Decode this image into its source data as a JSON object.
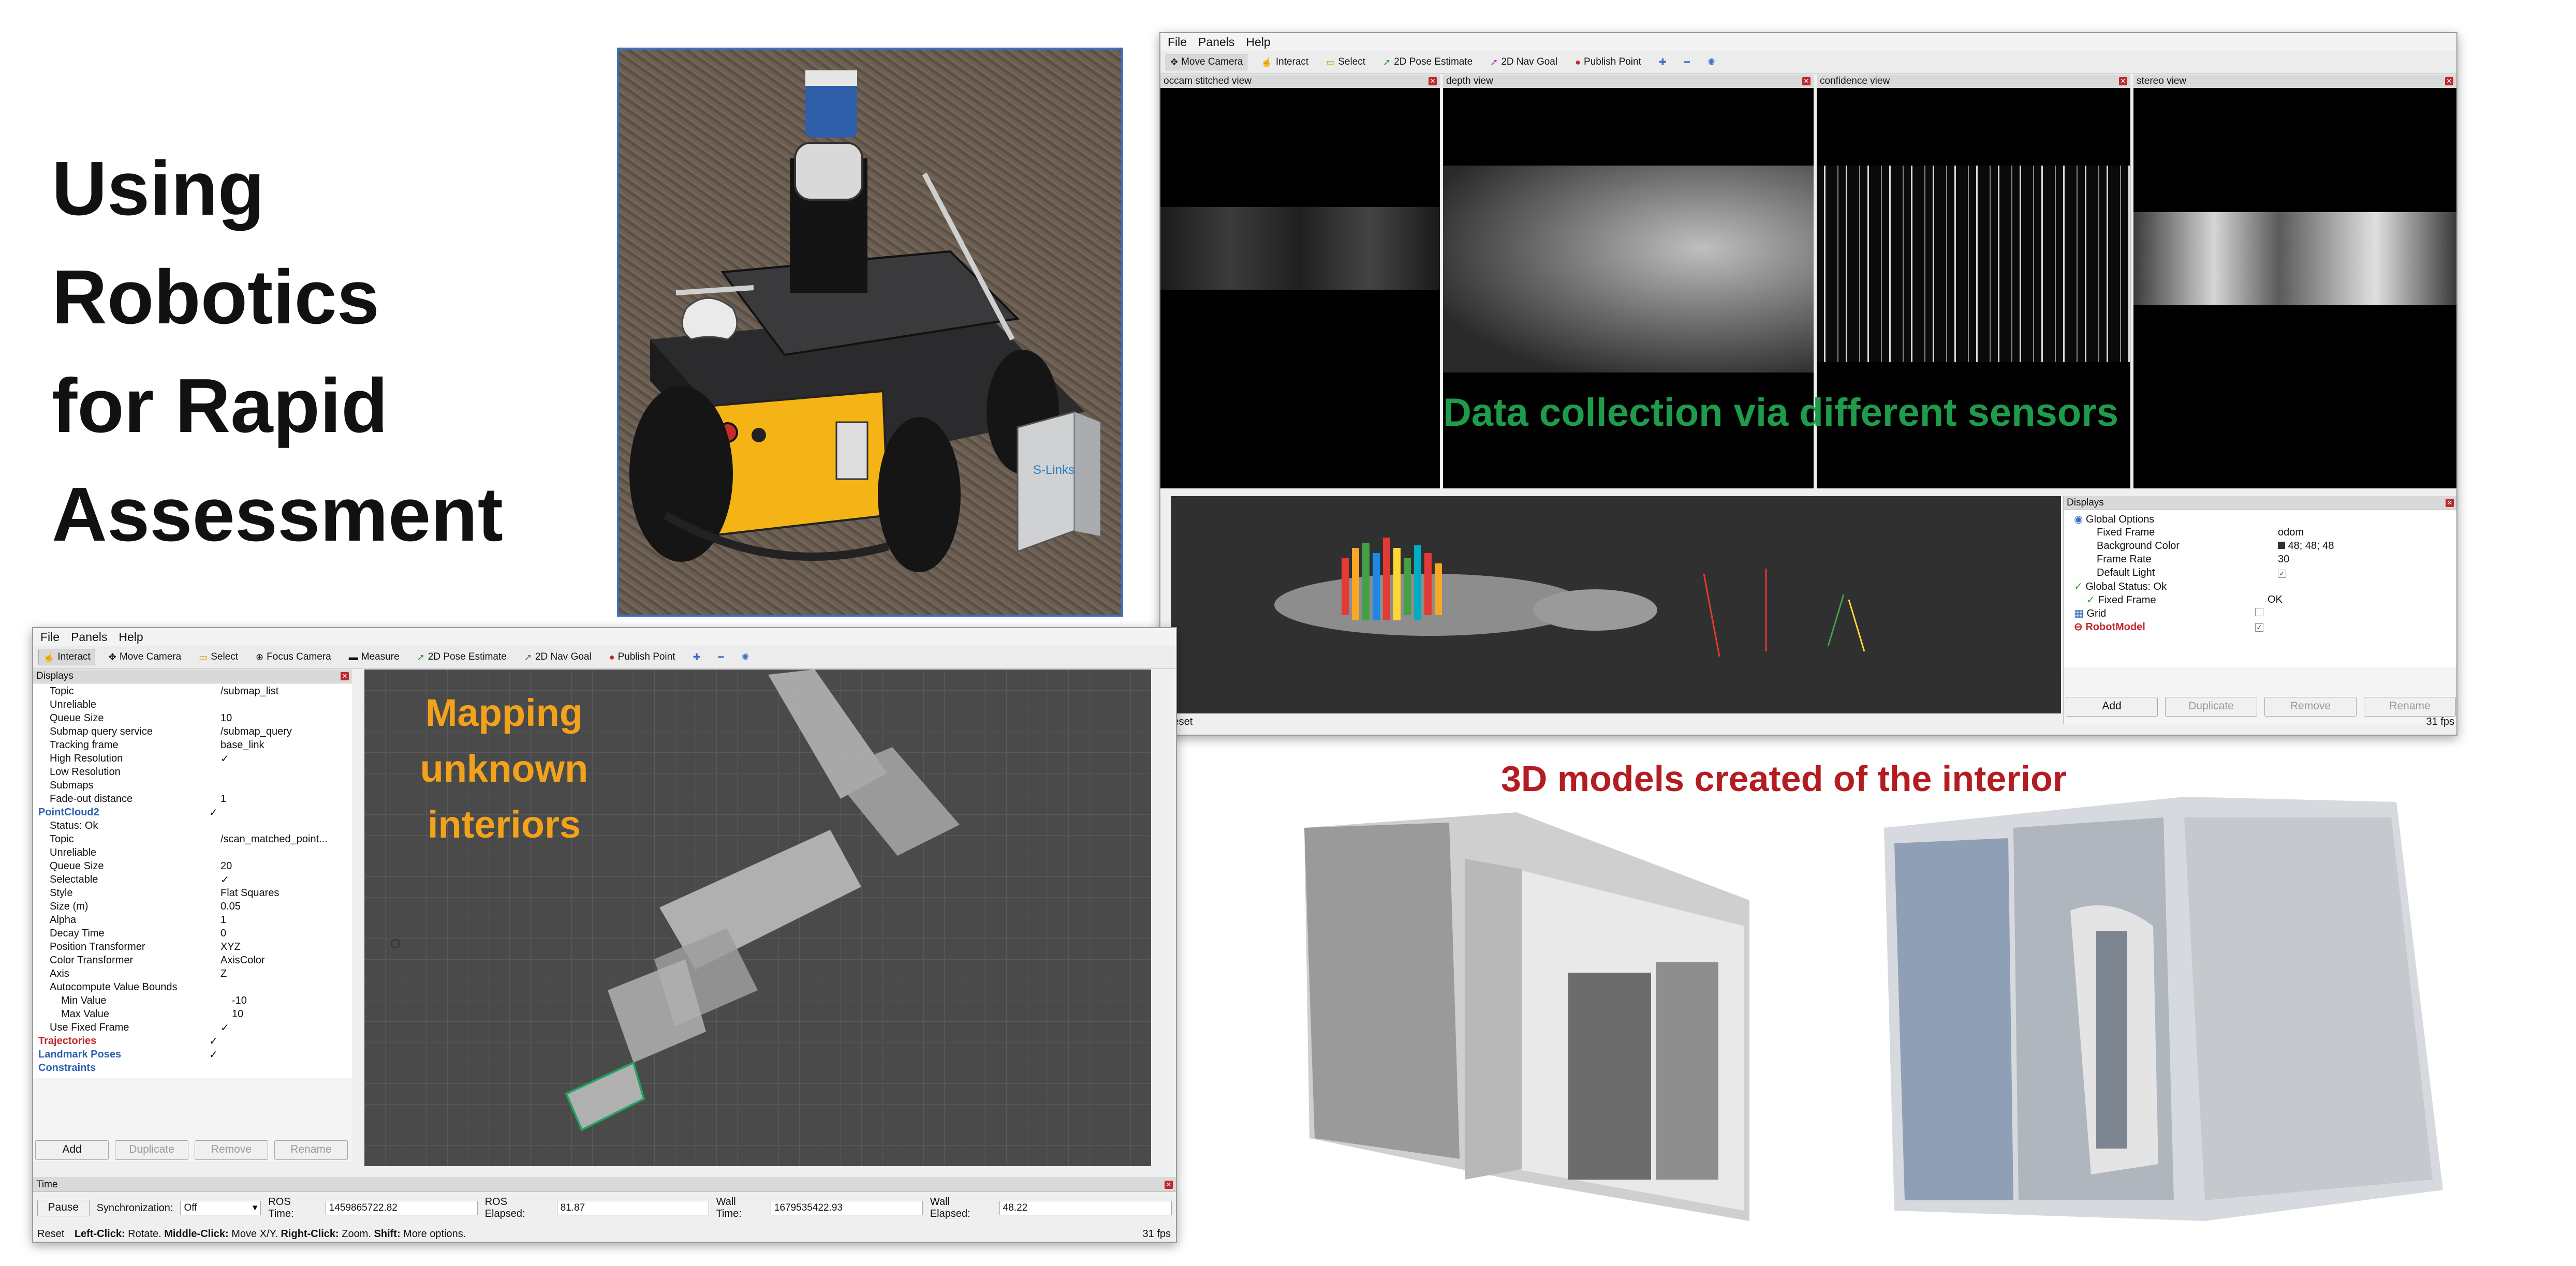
{
  "slide": {
    "title": "Using Robotics\nfor Rapid\nAssessment",
    "caption_3d": "3D models created of the interior"
  },
  "photo": {
    "box_label": "S-Links"
  },
  "rviz_top": {
    "menu": [
      "File",
      "Panels",
      "Help"
    ],
    "toolbar": [
      {
        "label": "Move Camera",
        "icon": "move-camera-icon"
      },
      {
        "label": "Interact",
        "icon": "interact-icon"
      },
      {
        "label": "Select",
        "icon": "select-icon"
      },
      {
        "label": "2D Pose Estimate",
        "icon": "pose-estimate-icon"
      },
      {
        "label": "2D Nav Goal",
        "icon": "nav-goal-icon"
      },
      {
        "label": "Publish Point",
        "icon": "publish-point-icon"
      }
    ],
    "views": [
      "occam stitched view",
      "depth view",
      "confidence view",
      "stereo view"
    ],
    "overlay_text": "Data collection via different sensors",
    "displays": {
      "title": "Displays",
      "rows": [
        {
          "key": "Global Options",
          "value": "",
          "level": 0
        },
        {
          "key": "Fixed Frame",
          "value": "odom",
          "level": 1
        },
        {
          "key": "Background Color",
          "value": "48; 48; 48",
          "level": 1
        },
        {
          "key": "Frame Rate",
          "value": "30",
          "level": 1
        },
        {
          "key": "Default Light",
          "value": "✓",
          "level": 1
        },
        {
          "key": "Global Status: Ok",
          "value": "",
          "level": 0
        },
        {
          "key": "Fixed Frame",
          "value": "OK",
          "level": 1
        },
        {
          "key": "Grid",
          "value": "",
          "level": 0
        },
        {
          "key": "RobotModel",
          "value": "✓",
          "level": 0
        }
      ],
      "buttons": [
        "Add",
        "Duplicate",
        "Remove",
        "Rename"
      ]
    },
    "reset": "Reset",
    "fps": "31 fps"
  },
  "rviz_bottom": {
    "menu": [
      "File",
      "Panels",
      "Help"
    ],
    "toolbar": [
      {
        "label": "Interact",
        "icon": "interact-icon"
      },
      {
        "label": "Move Camera",
        "icon": "move-camera-icon"
      },
      {
        "label": "Select",
        "icon": "select-icon"
      },
      {
        "label": "Focus Camera",
        "icon": "focus-camera-icon"
      },
      {
        "label": "Measure",
        "icon": "measure-icon"
      },
      {
        "label": "2D Pose Estimate",
        "icon": "pose-estimate-icon"
      },
      {
        "label": "2D Nav Goal",
        "icon": "nav-goal-icon"
      },
      {
        "label": "Publish Point",
        "icon": "publish-point-icon"
      }
    ],
    "displays_title": "Displays",
    "props": [
      {
        "k": "Topic",
        "v": "/submap_list",
        "indent": 1
      },
      {
        "k": "Unreliable",
        "v": "",
        "indent": 1
      },
      {
        "k": "Queue Size",
        "v": "10",
        "indent": 1
      },
      {
        "k": "Submap query service",
        "v": "/submap_query",
        "indent": 1
      },
      {
        "k": "Tracking frame",
        "v": "base_link",
        "indent": 1
      },
      {
        "k": "High Resolution",
        "v": "✓",
        "indent": 1
      },
      {
        "k": "Low Resolution",
        "v": "",
        "indent": 1
      },
      {
        "k": "Submaps",
        "v": "",
        "indent": 1
      },
      {
        "k": "Fade-out distance",
        "v": "1",
        "indent": 1
      },
      {
        "k": "PointCloud2",
        "v": "✓",
        "indent": 0
      },
      {
        "k": "Status: Ok",
        "v": "",
        "indent": 1
      },
      {
        "k": "Topic",
        "v": "/scan_matched_point...",
        "indent": 1
      },
      {
        "k": "Unreliable",
        "v": "",
        "indent": 1
      },
      {
        "k": "Queue Size",
        "v": "20",
        "indent": 1
      },
      {
        "k": "Selectable",
        "v": "✓",
        "indent": 1
      },
      {
        "k": "Style",
        "v": "Flat Squares",
        "indent": 1
      },
      {
        "k": "Size (m)",
        "v": "0.05",
        "indent": 1
      },
      {
        "k": "Alpha",
        "v": "1",
        "indent": 1
      },
      {
        "k": "Decay Time",
        "v": "0",
        "indent": 1
      },
      {
        "k": "Position Transformer",
        "v": "XYZ",
        "indent": 1
      },
      {
        "k": "Color Transformer",
        "v": "AxisColor",
        "indent": 1
      },
      {
        "k": "Axis",
        "v": "Z",
        "indent": 1
      },
      {
        "k": "Autocompute Value Bounds",
        "v": "",
        "indent": 1
      },
      {
        "k": "Min Value",
        "v": "-10",
        "indent": 2
      },
      {
        "k": "Max Value",
        "v": "10",
        "indent": 2
      },
      {
        "k": "Use Fixed Frame",
        "v": "✓",
        "indent": 1
      },
      {
        "k": "Trajectories",
        "v": "✓",
        "indent": 0
      },
      {
        "k": "Landmark Poses",
        "v": "✓",
        "indent": 0
      },
      {
        "k": "Constraints",
        "v": "",
        "indent": 0
      }
    ],
    "buttons": [
      "Add",
      "Duplicate",
      "Remove",
      "Rename"
    ],
    "overlay_text": "Mapping\nunknown\ninteriors",
    "time": {
      "title": "Time",
      "pause": "Pause",
      "sync_label": "Synchronization:",
      "sync_value": "Off",
      "ros_time_label": "ROS Time:",
      "ros_time": "1459865722.82",
      "ros_elapsed_label": "ROS Elapsed:",
      "ros_elapsed": "81.87",
      "wall_time_label": "Wall Time:",
      "wall_time": "1679535422.93",
      "wall_elapsed_label": "Wall Elapsed:",
      "wall_elapsed": "48.22"
    },
    "status": {
      "reset": "Reset",
      "hint_left_click": "Left-Click:",
      "hint_rotate": "Rotate.",
      "hint_middle_click": "Middle-Click:",
      "hint_move": "Move X/Y.",
      "hint_right_click": "Right-Click:",
      "hint_zoom": "Zoom.",
      "hint_shift": "Shift:",
      "hint_more": "More options."
    },
    "fps": "31 fps"
  },
  "colors": {
    "accent_green": "#1e9b4b",
    "accent_orange": "#f2a31b",
    "accent_red": "#b31d22",
    "rviz_bg": "#303030"
  }
}
